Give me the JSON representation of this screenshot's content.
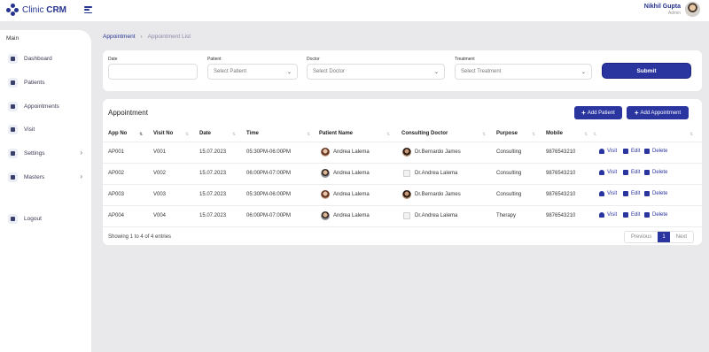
{
  "app": {
    "brand_prefix": "Clinic ",
    "brand_strong": "CRM"
  },
  "user": {
    "name": "Nikhil Gupta",
    "role": "Admin"
  },
  "sidebar": {
    "section": "Main",
    "items": [
      {
        "label": "Dashboard",
        "icon": "dashboard-icon"
      },
      {
        "label": "Patients",
        "icon": "patients-icon"
      },
      {
        "label": "Appointments",
        "icon": "appointments-icon"
      },
      {
        "label": "Visit",
        "icon": "visit-icon"
      },
      {
        "label": "Settings",
        "icon": "settings-icon",
        "chevron": "›"
      },
      {
        "label": "Masters",
        "icon": "masters-icon",
        "chevron": "›"
      }
    ],
    "logout": "Logout"
  },
  "breadcrumb": {
    "parent": "Appointment",
    "separator": "›",
    "current": "Appointment List"
  },
  "filters": {
    "date": {
      "label": "Date",
      "value": ""
    },
    "patient": {
      "label": "Patient",
      "value": "Select Patient"
    },
    "doctor": {
      "label": "Doctor",
      "value": "Select Doctor"
    },
    "treatment": {
      "label": "Treatment",
      "value": "Select Treatment"
    },
    "submit": "Submit"
  },
  "table": {
    "title": "Appointment",
    "add_patient": "Add Patient",
    "add_appointment": "Add Appointment",
    "columns": [
      "App No",
      "Visit No",
      "Date",
      "Time",
      "Patient Name",
      "Consulting Doctor",
      "Purpose",
      "Mobile"
    ],
    "rows": [
      {
        "app_no": "AP001",
        "visit_no": "V001",
        "date": "15.07.2023",
        "time": "05:30PM-06:00PM",
        "patient": "Andrea Lalema",
        "doctor": "Dr.Bernardo James",
        "purpose": "Consulting",
        "mobile": "9876543210"
      },
      {
        "app_no": "AP002",
        "visit_no": "V002",
        "date": "15.07.2023",
        "time": "06:00PM-07:00PM",
        "patient": "Andrea Lalema",
        "doctor": "Dr.Andrea Lalema",
        "purpose": "Consulting",
        "mobile": "9876543210"
      },
      {
        "app_no": "AP003",
        "visit_no": "V003",
        "date": "15.07.2023",
        "time": "05:30PM-06:00PM",
        "patient": "Andrea Lalema",
        "doctor": "Dr.Bernardo James",
        "purpose": "Consulting",
        "mobile": "9876543210"
      },
      {
        "app_no": "AP004",
        "visit_no": "V004",
        "date": "15.07.2023",
        "time": "06:00PM-07:00PM",
        "patient": "Andrea Lalema",
        "doctor": "Dr.Andrea Lalema",
        "purpose": "Therapy",
        "mobile": "9876543210"
      }
    ],
    "actions": {
      "visit": "Visit",
      "edit": "Edit",
      "delete": "Delete"
    },
    "entries": "Showing 1 to 4 of 4 entries",
    "pagination": {
      "previous": "Previous",
      "page": "1",
      "next": "Next"
    }
  },
  "colors": {
    "accent": "#2a35a0",
    "background": "#e9e9ec"
  }
}
